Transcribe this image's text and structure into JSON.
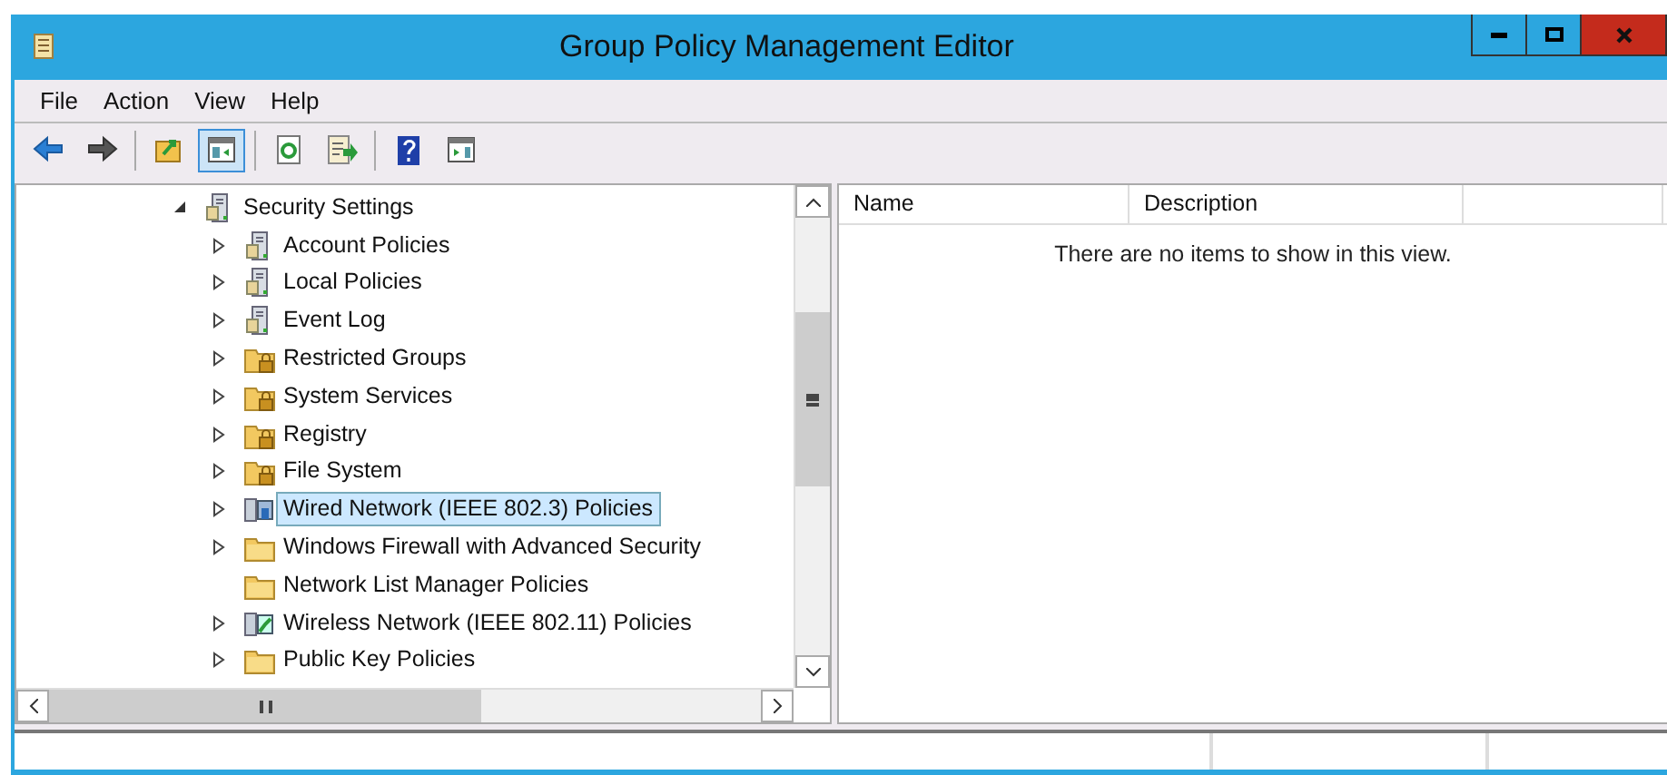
{
  "window": {
    "title": "Group Policy Management Editor"
  },
  "menu": [
    "File",
    "Action",
    "View",
    "Help"
  ],
  "toolbar": [
    {
      "kind": "back",
      "pressed": false
    },
    {
      "kind": "forward",
      "pressed": false
    },
    {
      "kind": "sep"
    },
    {
      "kind": "up",
      "pressed": false
    },
    {
      "kind": "tree",
      "pressed": true
    },
    {
      "kind": "sep"
    },
    {
      "kind": "refresh",
      "pressed": false
    },
    {
      "kind": "export",
      "pressed": false
    },
    {
      "kind": "sep"
    },
    {
      "kind": "help",
      "pressed": false
    },
    {
      "kind": "pane",
      "pressed": false
    }
  ],
  "tree": {
    "label": "Security Settings",
    "kind": "server",
    "expanded": true,
    "selected": false,
    "children": [
      {
        "label": "Account Policies",
        "kind": "server",
        "expandable": true,
        "selected": false
      },
      {
        "label": "Local Policies",
        "kind": "server",
        "expandable": true,
        "selected": false
      },
      {
        "label": "Event Log",
        "kind": "server",
        "expandable": true,
        "selected": false
      },
      {
        "label": "Restricted Groups",
        "kind": "lockfolder",
        "expandable": true,
        "selected": false
      },
      {
        "label": "System Services",
        "kind": "lockfolder",
        "expandable": true,
        "selected": false
      },
      {
        "label": "Registry",
        "kind": "lockfolder",
        "expandable": true,
        "selected": false
      },
      {
        "label": "File System",
        "kind": "lockfolder",
        "expandable": true,
        "selected": false
      },
      {
        "label": "Wired Network (IEEE 802.3) Policies",
        "kind": "network",
        "expandable": true,
        "selected": true
      },
      {
        "label": "Windows Firewall with Advanced Security",
        "kind": "folder",
        "expandable": true,
        "selected": false
      },
      {
        "label": "Network List Manager Policies",
        "kind": "folder",
        "expandable": false,
        "selected": false
      },
      {
        "label": "Wireless Network (IEEE 802.11) Policies",
        "kind": "wireless",
        "expandable": true,
        "selected": false
      },
      {
        "label": "Public Key Policies",
        "kind": "folder",
        "expandable": true,
        "selected": false
      }
    ]
  },
  "list": {
    "columns": [
      "Name",
      "Description"
    ],
    "empty_message": "There are no items to show in this view."
  }
}
